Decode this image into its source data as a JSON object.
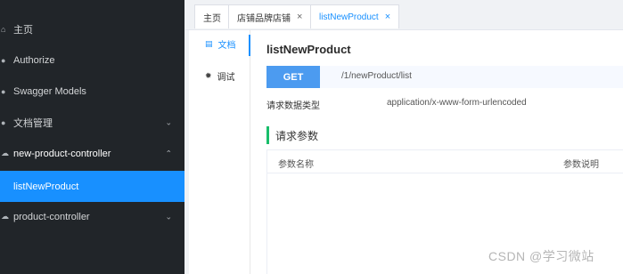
{
  "sidebar": {
    "items": [
      {
        "label": "主页",
        "icon": "home-icon"
      },
      {
        "label": "Authorize",
        "icon": "key-icon"
      },
      {
        "label": "Swagger Models",
        "icon": "models-icon"
      },
      {
        "label": "文档管理",
        "icon": "settings-icon"
      },
      {
        "label": "new-product-controller",
        "icon": "cloud-icon"
      },
      {
        "label": "listNewProduct"
      },
      {
        "label": "product-controller",
        "icon": "cloud-icon"
      }
    ],
    "active_color": "#1890ff"
  },
  "tabs": [
    {
      "label": "主页"
    },
    {
      "label": "店铺品牌店铺"
    },
    {
      "label": "listNewProduct"
    }
  ],
  "subnav": {
    "items": [
      {
        "label": "文档",
        "icon": "document-icon"
      },
      {
        "label": "调试",
        "icon": "debug-icon"
      }
    ]
  },
  "doc": {
    "title": "listNewProduct",
    "method": "GET",
    "path": "/1/newProduct/list",
    "request_type_label": "请求数据类型",
    "request_type_value": "application/x-www-form-urlencoded",
    "params_heading": "请求参数",
    "table_headers": [
      "参数名称",
      "参数说明"
    ]
  },
  "watermark": "CSDN @学习微站",
  "colors": {
    "sidebar_bg": "#212529",
    "accent": "#1890ff",
    "get_button": "#4c9bf0",
    "param_accent": "#19be6b"
  }
}
